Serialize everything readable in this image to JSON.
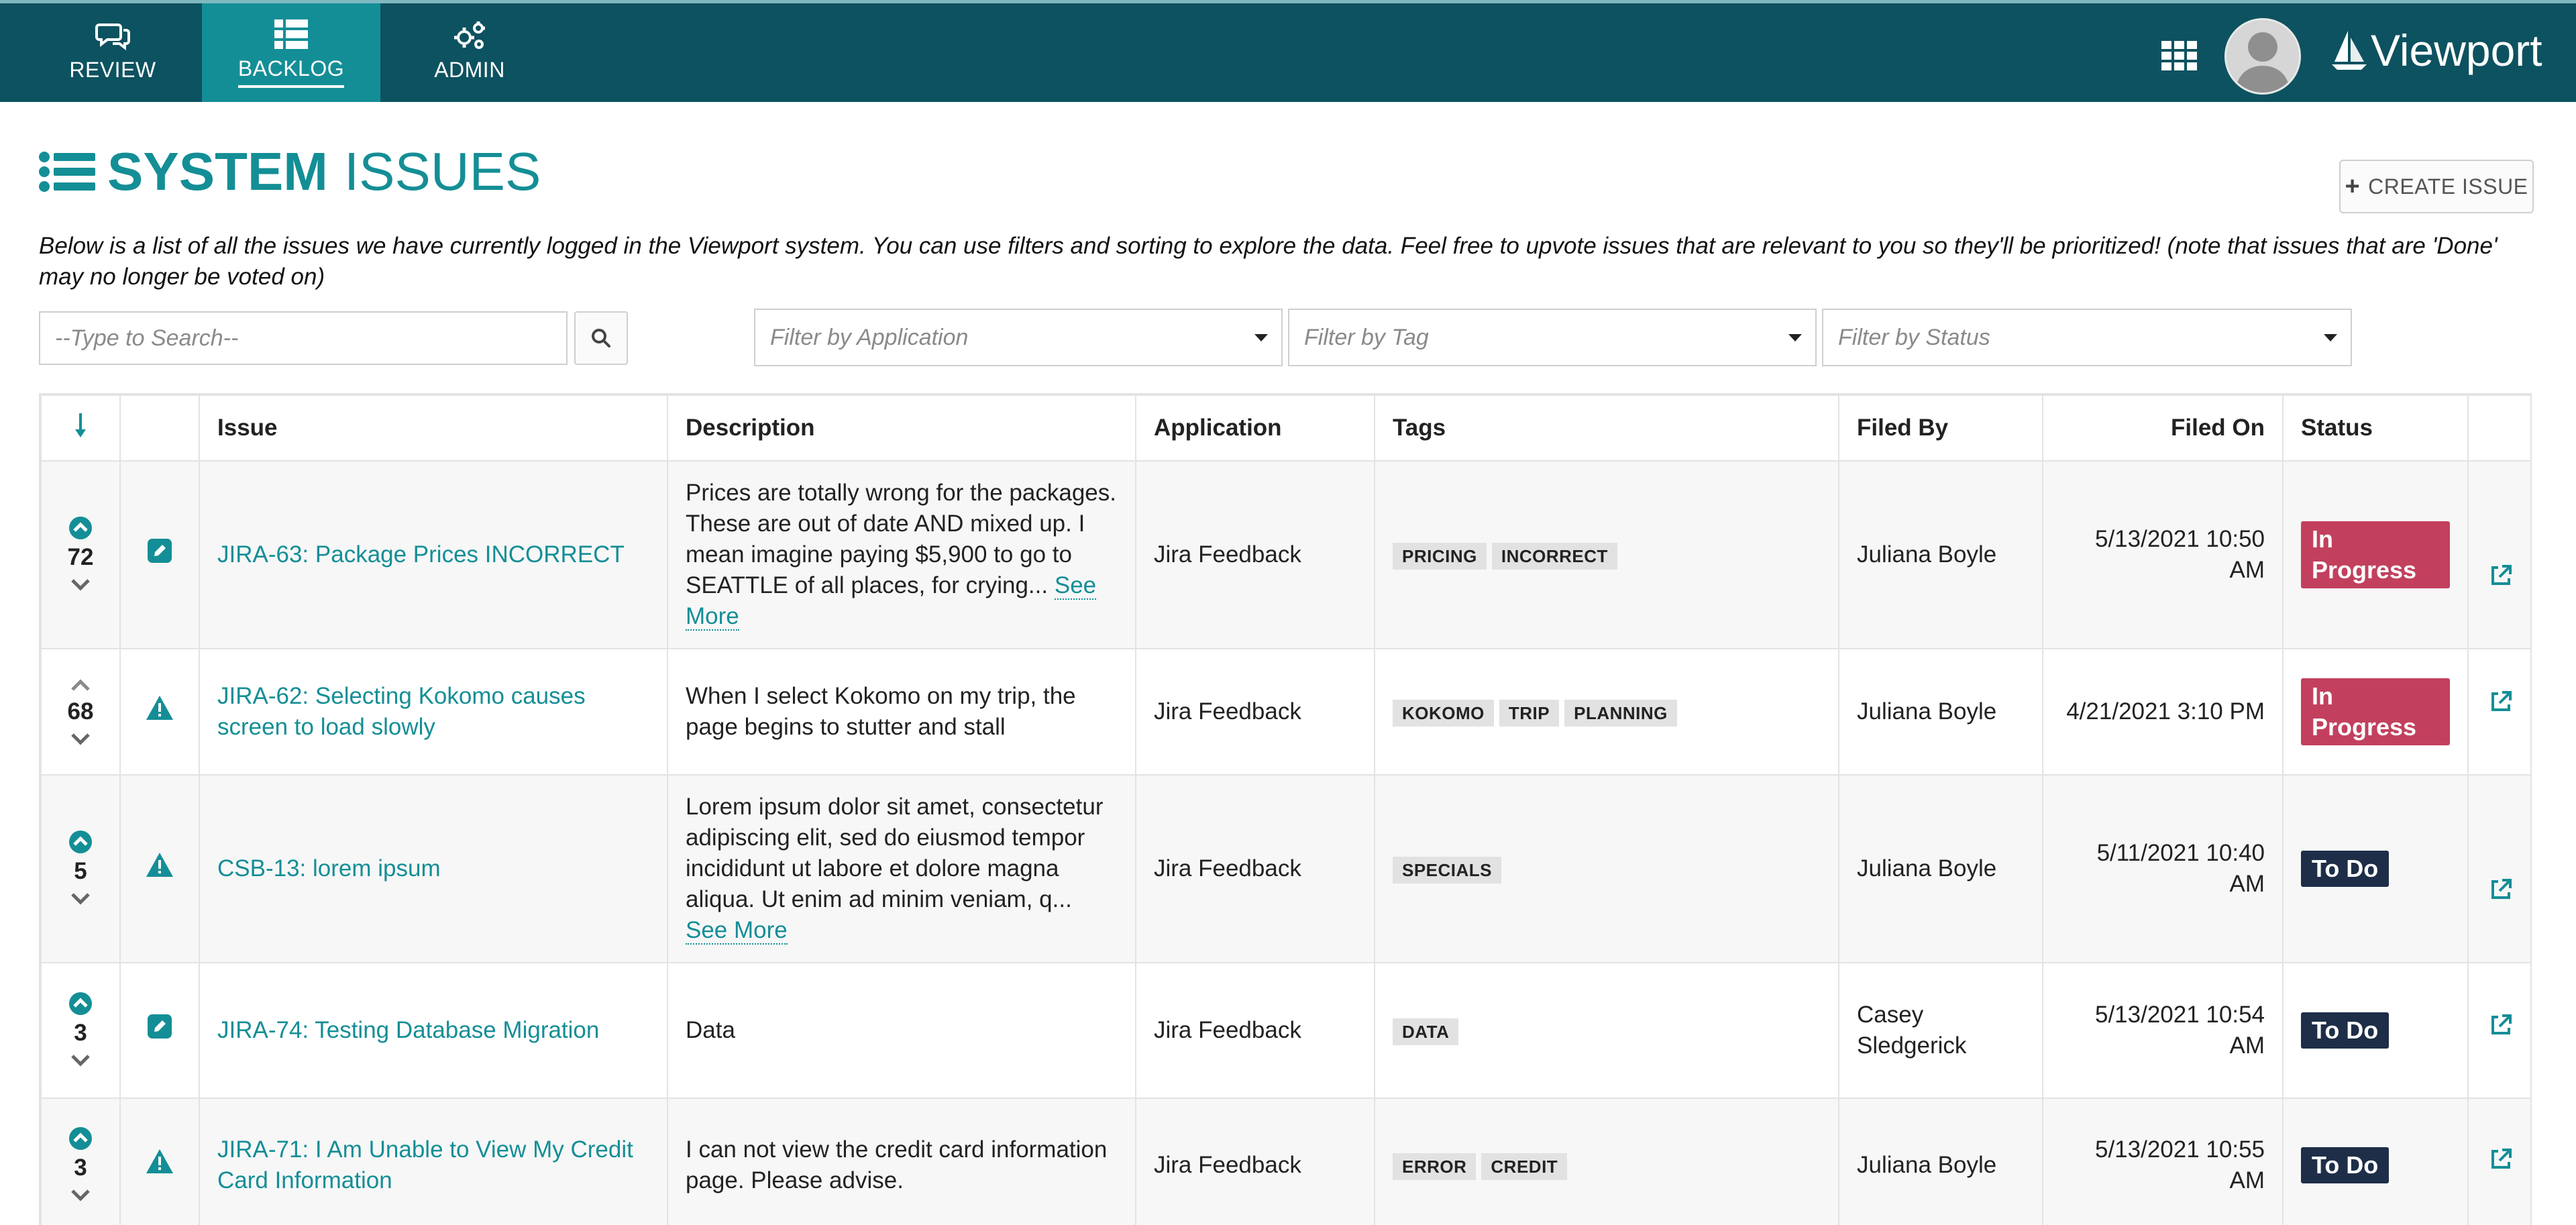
{
  "nav": {
    "tabs": [
      {
        "label": "REVIEW",
        "icon": "comments-icon"
      },
      {
        "label": "BACKLOG",
        "icon": "list-icon"
      },
      {
        "label": "ADMIN",
        "icon": "gears-icon"
      }
    ],
    "active_tab": "BACKLOG",
    "brand": "Viewport"
  },
  "header": {
    "title_bold": "SYSTEM",
    "title_light": "ISSUES",
    "create_label": "CREATE ISSUE",
    "intro": "Below is a list of all the issues we have currently logged in the Viewport system. You can use filters and sorting to explore the data. Feel free to upvote issues that are relevant to you so they'll be prioritized! (note that issues that are 'Done' may no longer be voted on)"
  },
  "filters": {
    "search_placeholder": "--Type to Search--",
    "application_placeholder": "Filter by Application",
    "tag_placeholder": "Filter by Tag",
    "status_placeholder": "Filter by Status"
  },
  "table": {
    "columns": [
      "",
      "",
      "Issue",
      "Description",
      "Application",
      "Tags",
      "Filed By",
      "Filed On",
      "Status",
      ""
    ],
    "rows": [
      {
        "votes": "72",
        "voted": true,
        "type": "edit",
        "issue": "JIRA-63: Package Prices INCORRECT",
        "description": "Prices are totally wrong for the packages. These are out of date AND mixed up. I mean imagine paying $5,900 to go to SEATTLE of all places, for crying...",
        "see_more": "See More",
        "application": "Jira Feedback",
        "tags": [
          "PRICING",
          "INCORRECT"
        ],
        "filed_by": "Juliana Boyle",
        "filed_on": "5/13/2021 10:50 AM",
        "status": "In Progress",
        "status_kind": "progress"
      },
      {
        "votes": "68",
        "voted": false,
        "type": "warning",
        "issue": "JIRA-62: Selecting Kokomo causes screen to load slowly",
        "description": "When I select Kokomo on my trip, the page begins to stutter and stall",
        "see_more": "",
        "application": "Jira Feedback",
        "tags": [
          "KOKOMO",
          "TRIP",
          "PLANNING"
        ],
        "filed_by": "Juliana Boyle",
        "filed_on": "4/21/2021 3:10 PM",
        "status": "In Progress",
        "status_kind": "progress"
      },
      {
        "votes": "5",
        "voted": true,
        "type": "warning",
        "issue": "CSB-13: lorem ipsum",
        "description": "Lorem ipsum dolor sit amet, consectetur adipiscing elit, sed do eiusmod tempor incididunt ut labore et dolore magna aliqua. Ut enim ad minim veniam, q...",
        "see_more": "See More",
        "application": "Jira Feedback",
        "tags": [
          "SPECIALS"
        ],
        "filed_by": "Juliana Boyle",
        "filed_on": "5/11/2021 10:40 AM",
        "status": "To Do",
        "status_kind": "todo"
      },
      {
        "votes": "3",
        "voted": true,
        "type": "edit",
        "issue": "JIRA-74: Testing Database Migration",
        "description": "Data",
        "see_more": "",
        "application": "Jira Feedback",
        "tags": [
          "DATA"
        ],
        "filed_by": "Casey Sledgerick",
        "filed_on": "5/13/2021 10:54 AM",
        "status": "To Do",
        "status_kind": "todo"
      },
      {
        "votes": "3",
        "voted": true,
        "type": "warning",
        "issue": "JIRA-71: I Am Unable to View My Credit Card Information",
        "description": "I can not view the credit card information page.  Please advise.",
        "see_more": "",
        "application": "Jira Feedback",
        "tags": [
          "ERROR",
          "CREDIT"
        ],
        "filed_by": "Juliana Boyle",
        "filed_on": "5/13/2021 10:55 AM",
        "status": "To Do",
        "status_kind": "todo"
      }
    ]
  },
  "colors": {
    "nav_bg": "#0d5260",
    "nav_active": "#148e96",
    "accent": "#148e96",
    "status_in_progress": "#c2405e",
    "status_todo": "#1e2e48"
  }
}
